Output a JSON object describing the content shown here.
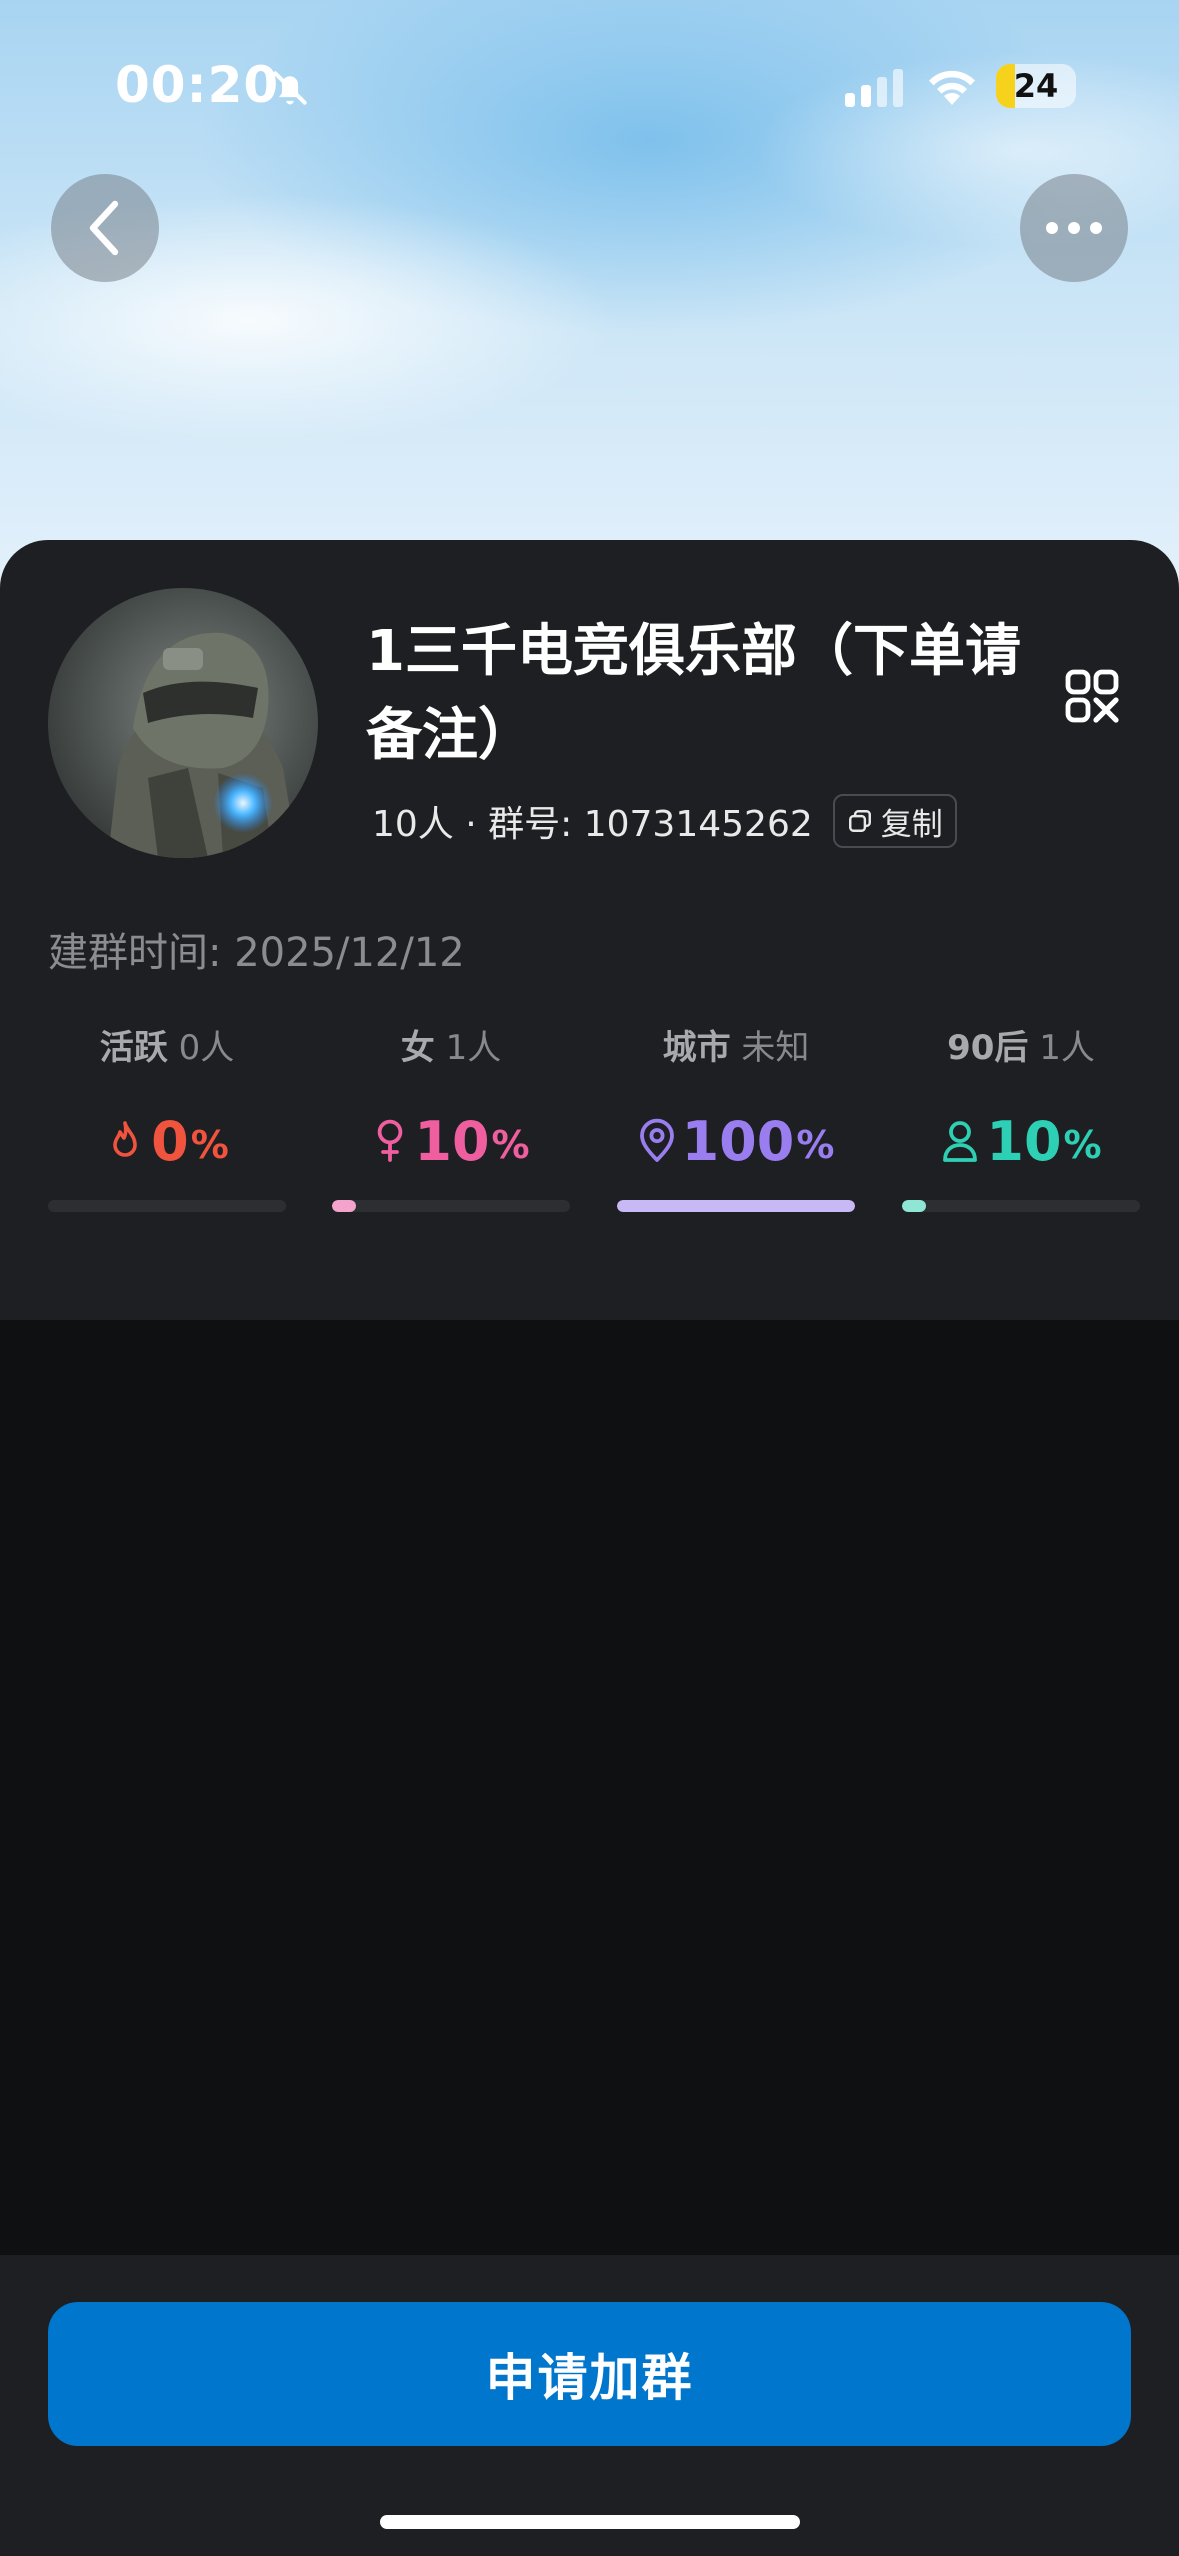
{
  "status_bar": {
    "time": "00:20",
    "battery_level": "24",
    "battery_fraction": 0.24,
    "icons": [
      "bell-muted-icon",
      "cellular-signal-icon",
      "wifi-icon",
      "battery-icon"
    ]
  },
  "header": {
    "back_icon": "chevron-left-icon",
    "more_icon": "ellipsis-icon"
  },
  "group": {
    "name": "1三千电竞俱乐部（下单请备注）",
    "members_and_id": "10人 · 群号: 1073145262",
    "copy_label": "复制",
    "created": "建群时间: 2025/12/12",
    "qr_icon": "qr-code-icon",
    "avatar_icon": "soldier-avatar-image"
  },
  "stats": [
    {
      "key": "活跃",
      "value": "0人",
      "number": "0",
      "unit": "%",
      "fraction": 0.0,
      "color": "#f0533e",
      "icon": "fire-icon"
    },
    {
      "key": "女",
      "value": "1人",
      "number": "10",
      "unit": "%",
      "fraction": 0.1,
      "color": "#ef5fa0",
      "icon": "female-icon"
    },
    {
      "key": "城市",
      "value": "未知",
      "number": "100",
      "unit": "%",
      "fraction": 1.0,
      "color": "#9a7ef0",
      "icon": "location-pin-icon"
    },
    {
      "key": "90后",
      "value": "1人",
      "number": "10",
      "unit": "%",
      "fraction": 0.1,
      "color": "#2ed0b5",
      "icon": "person-icon"
    }
  ],
  "bar_colors": [
    "#3a3b3f",
    "#f4a3cc",
    "#c9b8f6",
    "#8fe6d4"
  ],
  "footer": {
    "join_label": "申请加群",
    "accent": "#0076cc"
  }
}
